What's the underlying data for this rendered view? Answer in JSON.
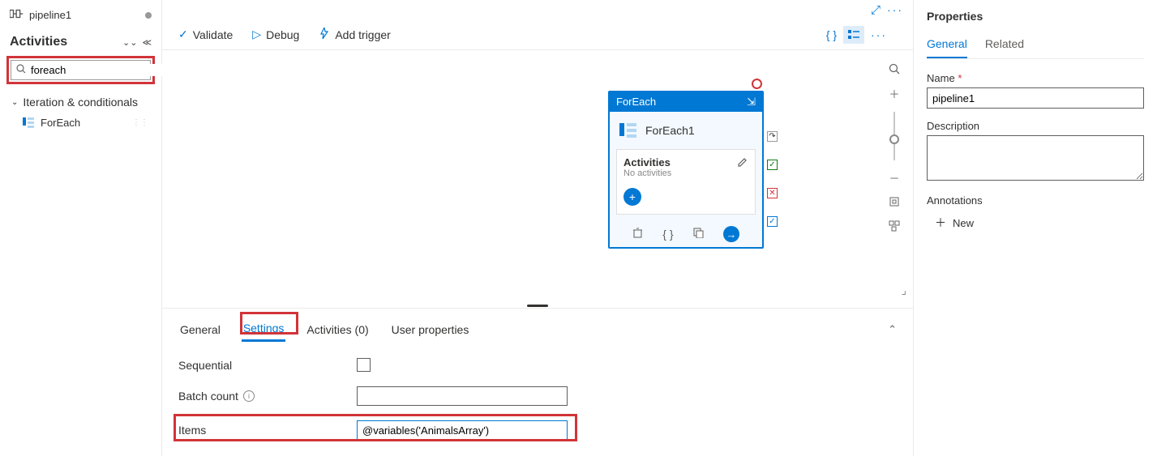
{
  "header": {
    "pipeline_name": "pipeline1"
  },
  "sidebar": {
    "title": "Activities",
    "search_value": "foreach",
    "group": "Iteration & conditionals",
    "item": "ForEach"
  },
  "toolbar": {
    "validate": "Validate",
    "debug": "Debug",
    "addtrigger": "Add trigger"
  },
  "node": {
    "type": "ForEach",
    "name": "ForEach1",
    "section_label": "Activities",
    "section_sub": "No activities"
  },
  "bottom_tabs": {
    "general": "General",
    "settings": "Settings",
    "activities": "Activities (0)",
    "userprops": "User properties"
  },
  "settings_form": {
    "sequential": "Sequential",
    "batchcount": "Batch count",
    "items": "Items",
    "items_value": "@variables('AnimalsArray')"
  },
  "properties": {
    "title": "Properties",
    "tab_general": "General",
    "tab_related": "Related",
    "name_label": "Name",
    "name_value": "pipeline1",
    "desc_label": "Description",
    "ann_label": "Annotations",
    "new_label": "New"
  }
}
